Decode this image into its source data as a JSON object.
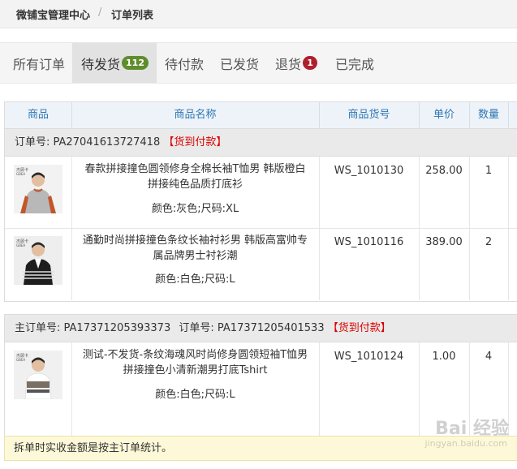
{
  "breadcrumb": {
    "home": "微铺宝管理中心",
    "separator": "/",
    "current": "订单列表"
  },
  "tabs": [
    {
      "label": "所有订单"
    },
    {
      "label": "待发货",
      "badge": "112"
    },
    {
      "label": "待付款"
    },
    {
      "label": "已发货"
    },
    {
      "label": "退货",
      "badge": "1"
    },
    {
      "label": "已完成"
    }
  ],
  "table": {
    "columns": [
      "商品",
      "商品名称",
      "商品货号",
      "单价",
      "数量"
    ]
  },
  "orders": [
    {
      "header_label": "订单号:",
      "order_no": "PA27041613727418",
      "tag": "【货到付款】",
      "items": [
        {
          "img_brand": "杰顾卡\nGBEA",
          "name": "春款拼接撞色圆领修身全棉长袖T恤男 韩版橙白拼接纯色品质打底衫",
          "spec": "颜色:灰色;尺码:XL",
          "sku": "WS_1010130",
          "price": "258.00",
          "qty": "1"
        },
        {
          "img_brand": "杰顾卡\nGBEA",
          "name": "通勤时尚拼接撞色条纹长袖衬衫男 韩版高富帅专属品牌男士衬衫潮",
          "spec": "颜色:白色;尺码:L",
          "sku": "WS_1010116",
          "price": "389.00",
          "qty": "2"
        }
      ]
    },
    {
      "header_label": "主订单号:",
      "main_order_no": "PA17371205393373",
      "sub_label": "订单号:",
      "order_no": "PA17371205401533",
      "tag": "【货到付款】",
      "items": [
        {
          "img_brand": "杰顾卡\nGBEA",
          "name": "测试-不发货-条纹海魂风时尚修身圆领短袖T恤男 拼接撞色小清新潮男打底Tshirt",
          "spec": "颜色:白色;尺码:L",
          "sku": "WS_1010124",
          "price": "1.00",
          "qty": "4"
        }
      ]
    }
  ],
  "note": "拆单时实收金额是按主订单统计。",
  "watermark": {
    "main": "Bai 经验",
    "sub": "jingyan.baidu.com"
  }
}
